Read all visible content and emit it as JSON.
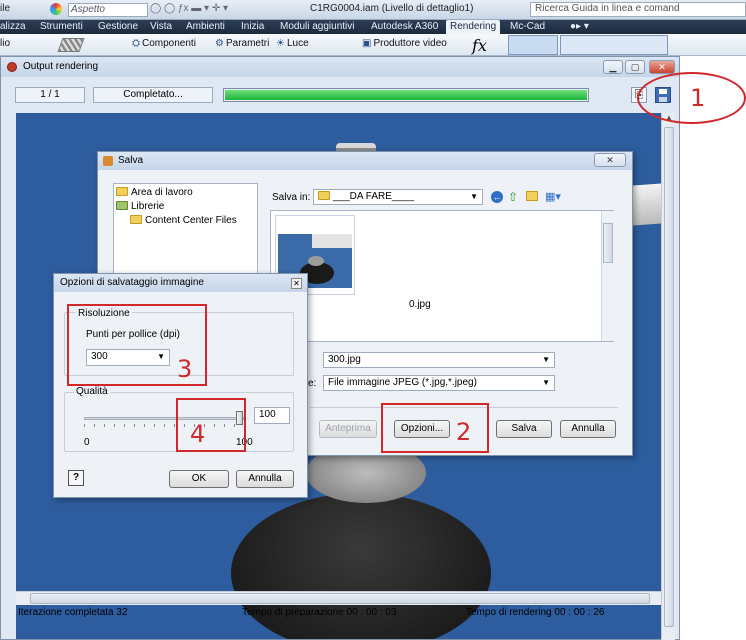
{
  "appbar": {
    "left_fragment": "ile",
    "style_dropdown": "Aspetto",
    "doc_title": "C1RG0004.iam (Livello di dettaglio1)",
    "help_search": "Ricerca Guida in linea e comand"
  },
  "menubar": {
    "items": [
      "alizza",
      "Strumenti",
      "Gestione",
      "Vista",
      "Ambienti",
      "Inizia",
      "Moduli aggiuntivi",
      "Autodesk A360",
      "Rendering",
      "Mc-Cad"
    ],
    "active": "Rendering"
  },
  "ribbon": {
    "left_fragment": "lio",
    "components": "Componenti",
    "params": "Parametri",
    "light": "Luce",
    "video": "Produttore video"
  },
  "output_window": {
    "title": "Output rendering",
    "counter": "1 / 1",
    "status": "Completato...",
    "progress": 1.0,
    "bottom": {
      "iterations": "Iterazione completata  32",
      "prep_time": "Tempo di preparazione   00 : 00 : 03",
      "render_time": "Tempo di rendering   00 : 00 : 26"
    }
  },
  "save_dialog": {
    "title": "Salva",
    "places": [
      "Area di lavoro",
      "Librerie",
      "Content Center Files"
    ],
    "lookin_label": "Salva in:",
    "lookin_value": "___DA FARE____",
    "thumb_label": "0.jpg",
    "filename_value": "300.jpg",
    "filetype_label": "e:",
    "filetype_value": "File immagine JPEG (*.jpg,*.jpeg)",
    "preview_button": "Anteprima",
    "options_button": "Opzioni...",
    "save_button": "Salva",
    "cancel_button": "Annulla"
  },
  "options_dialog": {
    "title": "Opzioni di salvataggio immagine",
    "resolution_label": "Risoluzione",
    "dpi_label": "Punti per pollice (dpi)",
    "dpi_value": "300",
    "quality_label": "Qualità",
    "quality_value": "100",
    "slider_min": "0",
    "slider_max": "100",
    "slider_level": 1.0,
    "ok_button": "OK",
    "cancel_button": "Annulla",
    "help_icon": "?"
  },
  "annotations": [
    "1",
    "2",
    "3",
    "4"
  ],
  "colors": {
    "annotation_red": "#d0282b",
    "progress_green": "#1fb53a",
    "render_background": "#2d5d9e"
  }
}
